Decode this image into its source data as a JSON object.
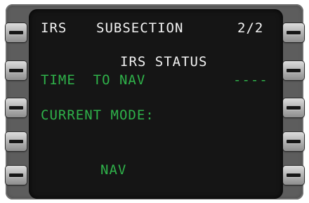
{
  "cdu": {
    "title_left": "IRS",
    "title_center": "SUBSECTION",
    "page": "2/2",
    "heading": "IRS STATUS",
    "time_label": "TIME  TO NAV",
    "time_value": "----",
    "mode_label": "CURRENT MODE:",
    "mode_value": "NAV"
  },
  "colors": {
    "text_white": "#f2f2f2",
    "text_green": "#2fb24a",
    "screen_bg": "#151515",
    "bezel": "#5d5d5d"
  }
}
